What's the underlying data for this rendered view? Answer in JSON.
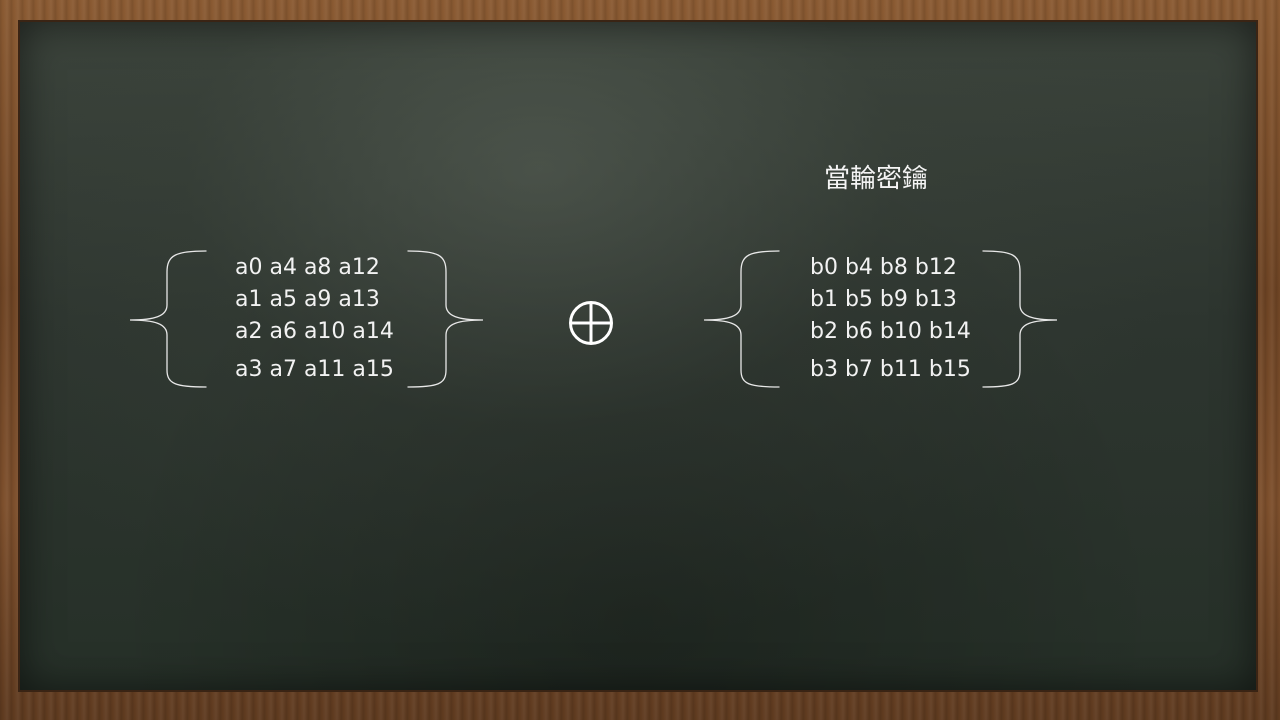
{
  "title": "當輪密鑰",
  "operator_icon": "xor-circled-plus-icon",
  "matrix_a": {
    "rows": [
      "a0 a4 a8 a12",
      "a1 a5 a9 a13",
      "a2 a6 a10 a14",
      "a3 a7 a11 a15"
    ]
  },
  "matrix_b": {
    "rows": [
      "b0 b4 b8 b12",
      "b1 b5 b9 b13",
      "b2 b6 b10 b14",
      "b3 b7 b11 b15"
    ]
  },
  "colors": {
    "chalk": "#f2f2f2",
    "board": "#2d352f",
    "frame": "#7d4f2c"
  }
}
